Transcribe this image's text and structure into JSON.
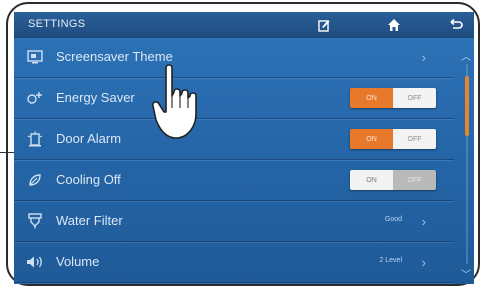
{
  "header": {
    "title": "SETTINGS",
    "icons": [
      "edit-icon",
      "home-icon",
      "back-icon"
    ]
  },
  "rows": [
    {
      "label": "Screensaver Theme",
      "icon": "screensaver-icon",
      "control": "chevron"
    },
    {
      "label": "Energy Saver",
      "icon": "energy-saver-icon",
      "control": "toggle",
      "on_label": "ON",
      "off_label": "OFF",
      "state": "on"
    },
    {
      "label": "Door Alarm",
      "icon": "door-alarm-icon",
      "control": "toggle",
      "on_label": "ON",
      "off_label": "OFF",
      "state": "on"
    },
    {
      "label": "Cooling Off",
      "icon": "cooling-off-icon",
      "control": "toggle",
      "on_label": "ON",
      "off_label": "OFF",
      "state": "off"
    },
    {
      "label": "Water Filter",
      "icon": "water-filter-icon",
      "control": "status",
      "status": "Good"
    },
    {
      "label": "Volume",
      "icon": "volume-icon",
      "control": "status",
      "status": "2 Level"
    }
  ],
  "colors": {
    "accent": "#e8782a",
    "screen": "#2566a8",
    "topbar": "#1e4c80"
  }
}
